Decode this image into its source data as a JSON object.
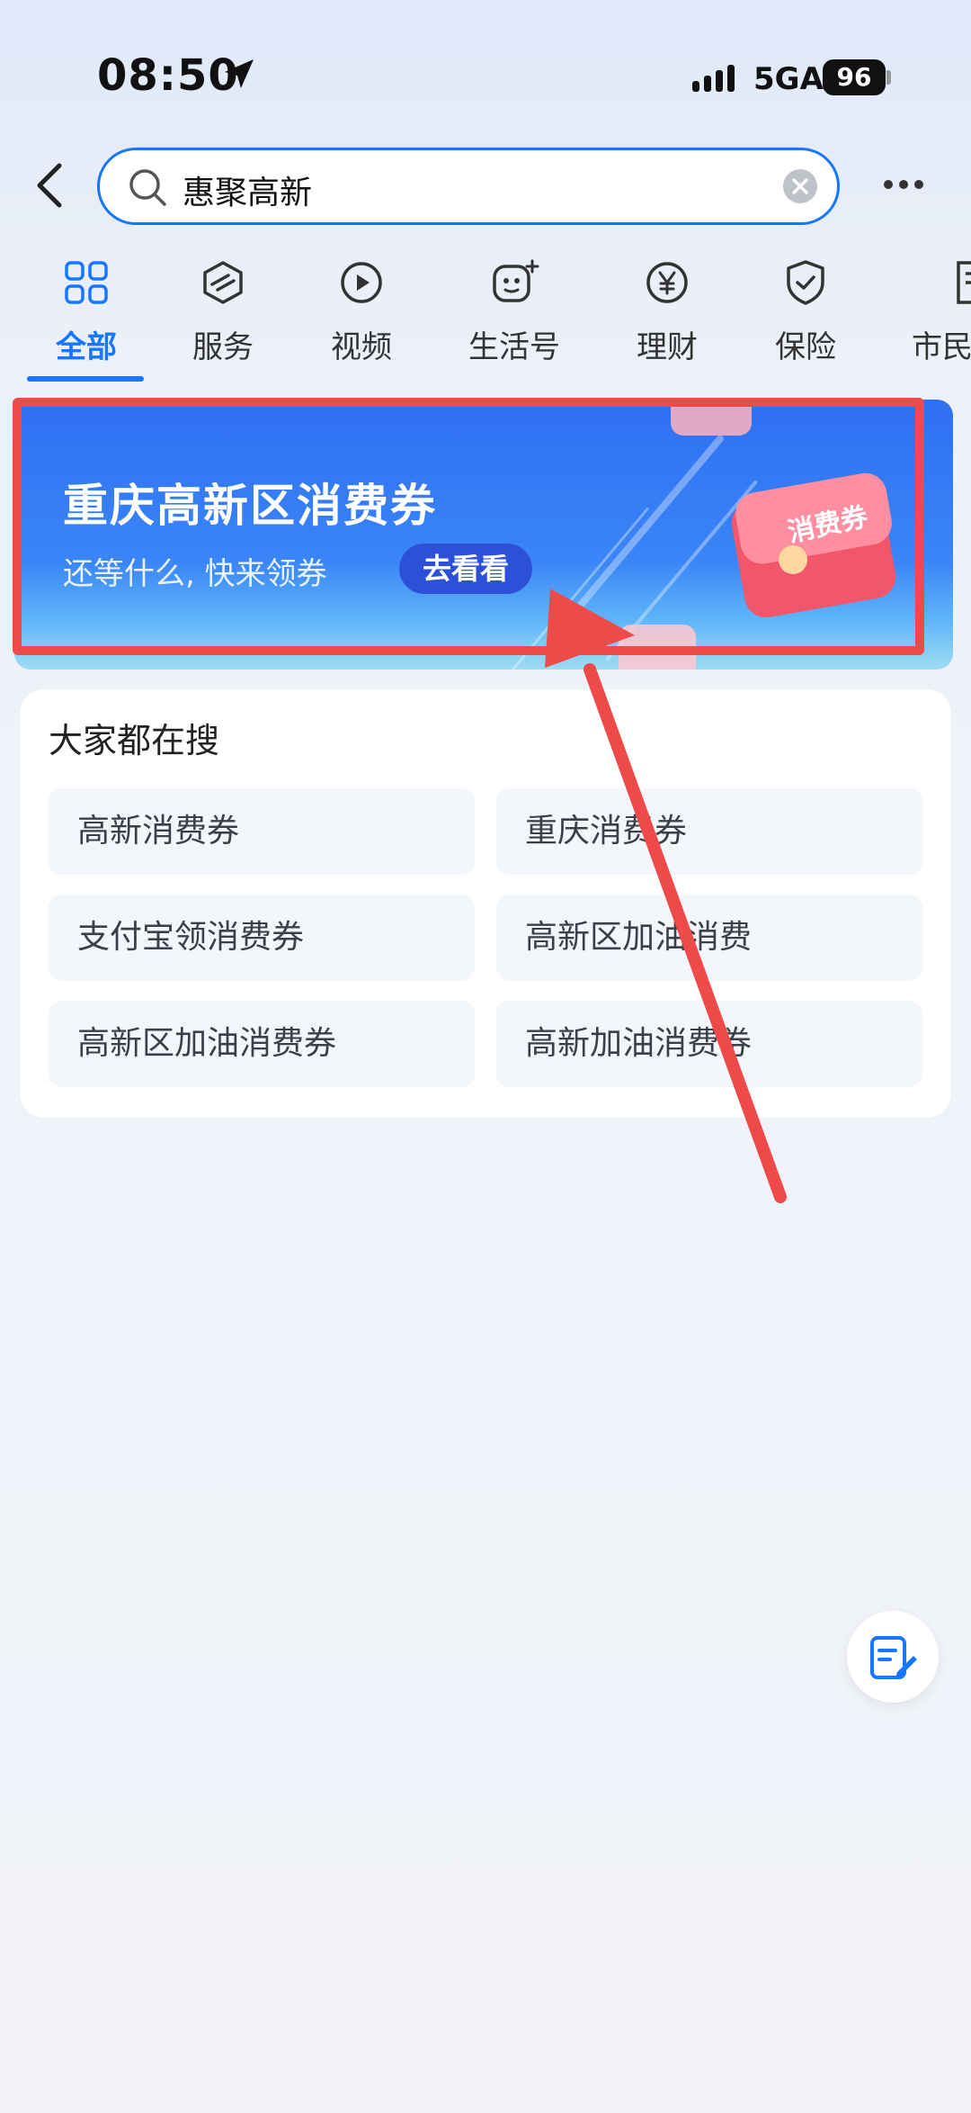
{
  "status_bar": {
    "time": "08:50",
    "network": "5GA",
    "battery": "96"
  },
  "search": {
    "query": "惠聚高新"
  },
  "tabs": [
    {
      "label": "全部",
      "icon": "grid-icon",
      "active": true
    },
    {
      "label": "服务",
      "icon": "cube-icon"
    },
    {
      "label": "视频",
      "icon": "play-icon"
    },
    {
      "label": "生活号",
      "icon": "face-icon"
    },
    {
      "label": "理财",
      "icon": "yen-icon"
    },
    {
      "label": "保险",
      "icon": "shield-check-icon"
    },
    {
      "label": "市民",
      "icon": "document-icon"
    }
  ],
  "banner": {
    "title": "重庆高新区消费券",
    "subtitle": "还等什么, 快来领券",
    "button": "去看看",
    "coupon_label": "消费券"
  },
  "trending": {
    "title": "大家都在搜",
    "items": [
      "高新消费券",
      "重庆消费券",
      "支付宝领消费券",
      "高新区加油消费",
      "高新区加油消费券",
      "高新加油消费券"
    ]
  },
  "colors": {
    "accent": "#1677ff",
    "highlight": "#ee4a4a",
    "banner_blue": "#3a85f7"
  }
}
